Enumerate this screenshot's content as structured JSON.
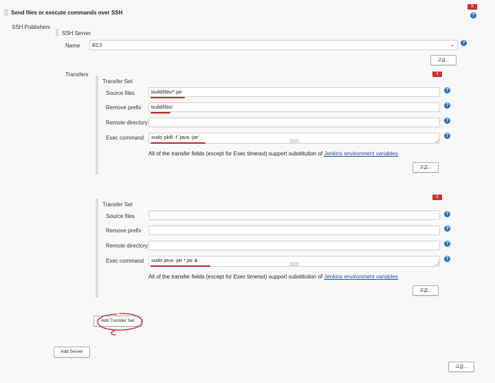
{
  "section": {
    "title": "Send files or execute commands over SSH",
    "close_label": "X",
    "publishers_label": "SSH Publishers"
  },
  "server": {
    "heading": "SSH Server",
    "name_label": "Name",
    "name_value": "EC2",
    "advanced_label": "고급...",
    "transfers_label": "Transfers",
    "add_server_label": "Add Server"
  },
  "transfer_sets": [
    {
      "heading": "Transfer Set",
      "close_label": "X",
      "source_files_label": "Source files",
      "source_files_value": "build/libs/*.jar",
      "remove_prefix_label": "Remove prefix",
      "remove_prefix_value": "build/libs/",
      "remote_directory_label": "Remote directory",
      "remote_directory_value": "",
      "exec_command_label": "Exec command",
      "exec_command_value": "sudo pkill -f 'java -jar'",
      "note_text": "All of the transfer fields (except for Exec timeout) support substitution of ",
      "note_link": "Jenkins environment variables",
      "advanced_label": "고급..."
    },
    {
      "heading": "Transfer Set",
      "close_label": "X",
      "source_files_label": "Source files",
      "source_files_value": "",
      "remove_prefix_label": "Remove prefix",
      "remove_prefix_value": "",
      "remote_directory_label": "Remote directory",
      "remote_directory_value": "",
      "exec_command_label": "Exec command",
      "exec_command_value": "sudo java -jar *.jar &",
      "note_text": "All of the transfer fields (except for Exec timeout) support substitution of ",
      "note_link": "Jenkins environment variables",
      "advanced_label": "고급..."
    }
  ],
  "add_transfer_set_label": "Add Transfer Set",
  "bottom_advanced_label": "고급...",
  "help_glyph": "?",
  "icons": [
    "help-icon",
    "close-icon",
    "dropdown-arrow-icon"
  ],
  "colors": {
    "annotation_red": "#c0202a",
    "help_blue": "#2f6fb3",
    "delete_red": "#c9302c",
    "link_blue": "#1f4fa0"
  }
}
